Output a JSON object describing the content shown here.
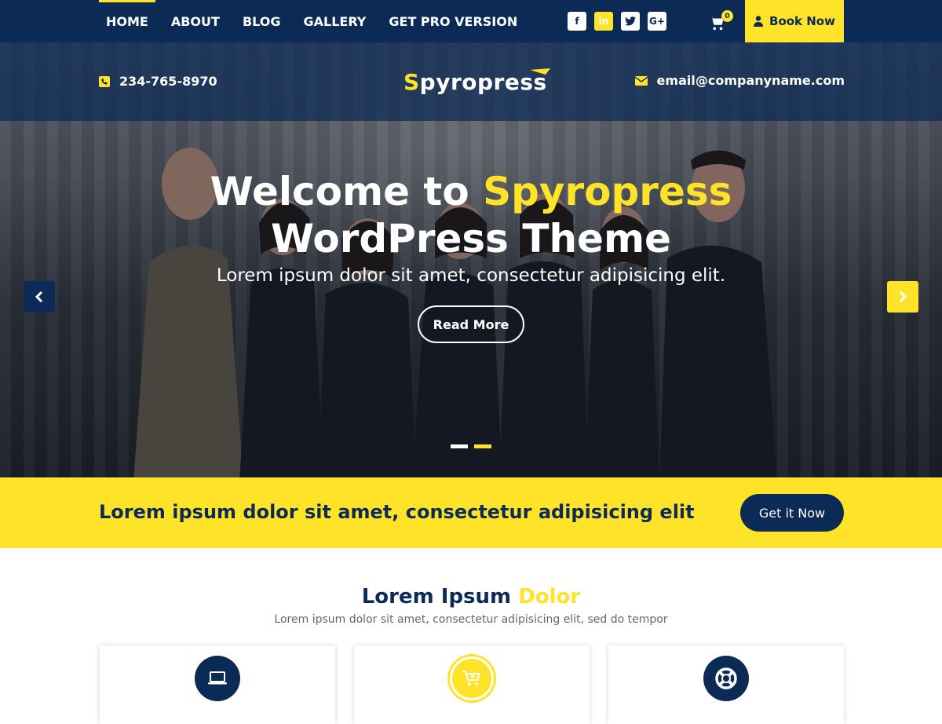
{
  "nav": {
    "items": [
      {
        "label": "HOME",
        "active": true
      },
      {
        "label": "ABOUT"
      },
      {
        "label": "BLOG"
      },
      {
        "label": "GALLERY"
      },
      {
        "label": "GET PRO VERSION"
      }
    ],
    "social": [
      "facebook-icon",
      "linkedin-icon",
      "twitter-icon",
      "google-plus-icon"
    ],
    "social_glyphs": {
      "facebook": "f",
      "linkedin": "in",
      "twitter": "t",
      "google": "G+"
    },
    "cart_count": "0",
    "book_label": "Book Now"
  },
  "header": {
    "phone": "234-765-8970",
    "email": "email@companyname.com",
    "logo_text": "pyropress",
    "logo_initial": "S"
  },
  "hero": {
    "title_pre": "Welcome to ",
    "title_accent": "Spyropress",
    "title_line2": "WordPress Theme",
    "subtitle": "Lorem ipsum dolor sit amet, consectetur adipisicing elit.",
    "button": "Read More",
    "slides": 2,
    "active_slide": 2
  },
  "cta": {
    "text": "Lorem ipsum dolor sit amet, consectetur adipisicing elit",
    "button": "Get it Now"
  },
  "services": {
    "title": "Lorem Ipsum",
    "title_accent": "Dolor",
    "subtitle": "Lorem ipsum dolor sit amet, consectetur adipisicing elit, sed do tempor",
    "cards": [
      {
        "icon": "laptop-icon"
      },
      {
        "icon": "shopping-cart-icon"
      },
      {
        "icon": "life-ring-icon"
      }
    ]
  },
  "colors": {
    "navy": "#0b2a55",
    "yellow": "#ffe328"
  }
}
